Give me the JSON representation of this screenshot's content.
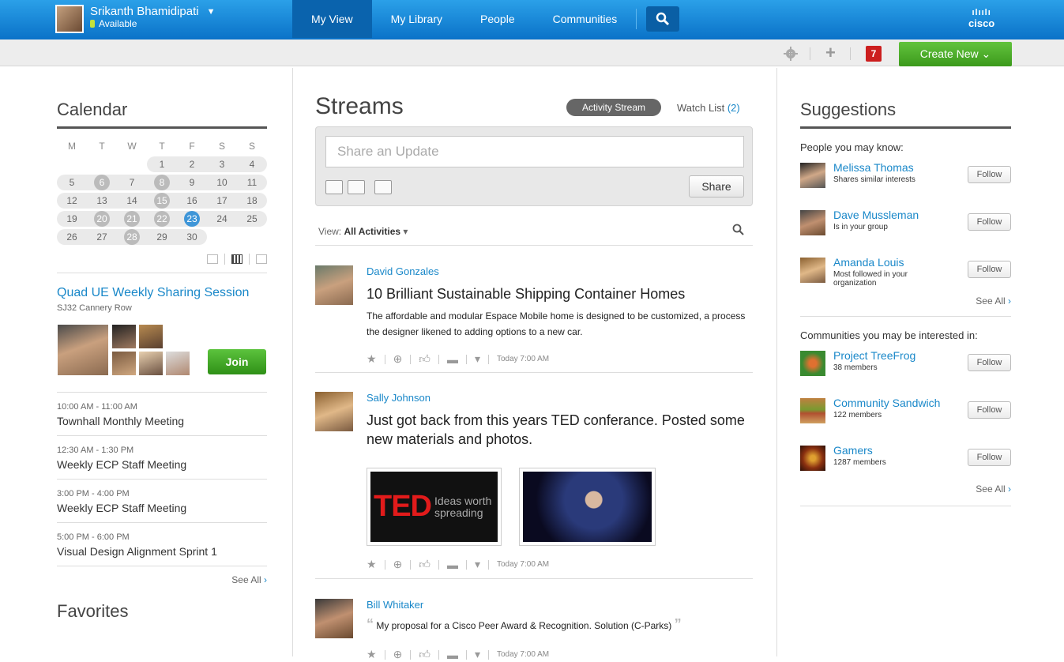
{
  "header": {
    "user_name": "Srikanth Bhamidipati",
    "user_status": "Available",
    "nav": [
      "My View",
      "My Library",
      "People",
      "Communities"
    ],
    "logo_text": "cisco"
  },
  "toolbar": {
    "notification_count": "7",
    "create_new_label": "Create New"
  },
  "calendar": {
    "title": "Calendar",
    "weekdays": [
      "M",
      "T",
      "W",
      "T",
      "F",
      "S",
      "S"
    ],
    "weeks": [
      [
        "",
        "",
        "",
        "",
        "1",
        "2",
        "3",
        "4"
      ],
      [
        "5",
        "6",
        "7",
        "8",
        "9",
        "10",
        "11"
      ],
      [
        "12",
        "13",
        "14",
        "15",
        "16",
        "17",
        "18"
      ],
      [
        "19",
        "20",
        "21",
        "22",
        "23",
        "24",
        "25"
      ],
      [
        "26",
        "27",
        "28",
        "29",
        "30"
      ]
    ],
    "busy_days": [
      "6",
      "8",
      "15",
      "20",
      "21",
      "22",
      "28"
    ],
    "today": "23"
  },
  "event": {
    "title": "Quad UE Weekly Sharing Session",
    "location": "SJ32 Cannery Row",
    "join_label": "Join"
  },
  "schedule": [
    {
      "time": "10:00 AM - 11:00 AM",
      "name": "Townhall Monthly Meeting"
    },
    {
      "time": "12:30 AM - 1:30 PM",
      "name": "Weekly ECP Staff Meeting"
    },
    {
      "time": "3:00 PM - 4:00 PM",
      "name": "Weekly ECP Staff Meeting"
    },
    {
      "time": "5:00 PM - 6:00 PM",
      "name": "Visual Design Alignment Sprint 1"
    }
  ],
  "see_all": "See All",
  "favorites_title": "Favorites",
  "streams": {
    "title": "Streams",
    "activity_stream_label": "Activity Stream",
    "watch_list_label": "Watch List",
    "watch_list_count": "(2)",
    "share_placeholder": "Share an Update",
    "share_label": "Share",
    "view_label": "View:",
    "view_value": "All Activities"
  },
  "posts": [
    {
      "author": "David Gonzales",
      "title": "10 Brilliant Sustainable Shipping Container Homes",
      "body": "The affordable and modular Espace Mobile home is designed to be customized, a process the designer likened to adding options to a new car.",
      "time": "Today 7:00 AM"
    },
    {
      "author": "Sally Johnson",
      "title": "Just got back from this years TED conferance. Posted some new materials and photos.",
      "image_ted_logo": "TED",
      "image_ted_tagline": "Ideas worth spreading",
      "time": "Today 7:00 AM"
    },
    {
      "author": "Bill Whitaker",
      "quote": "My proposal for a Cisco Peer Award & Recognition. Solution (C-Parks)",
      "time": "Today 7:00 AM"
    }
  ],
  "suggestions": {
    "title": "Suggestions",
    "people_label": "People you may know:",
    "people": [
      {
        "name": "Melissa Thomas",
        "desc": "Shares similar interests"
      },
      {
        "name": "Dave Mussleman",
        "desc": "Is in your group"
      },
      {
        "name": "Amanda Louis",
        "desc": "Most followed in your organization"
      }
    ],
    "communities_label": "Communities you may be interested in:",
    "communities": [
      {
        "name": "Project TreeFrog",
        "desc": "38 members"
      },
      {
        "name": "Community Sandwich",
        "desc": "122 members"
      },
      {
        "name": "Gamers",
        "desc": "1287 members"
      }
    ],
    "follow_label": "Follow"
  }
}
